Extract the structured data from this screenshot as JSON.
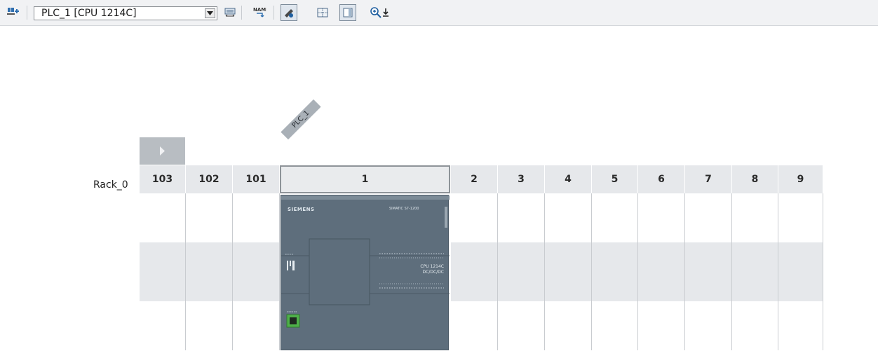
{
  "toolbar": {
    "device_selector_value": "PLC_1 [CPU 1214C]",
    "icons": [
      "network-device-icon",
      "dropdown-arrow-icon",
      "rack-overview-icon",
      "name-tag-icon",
      "show-module-icon",
      "grid-icon",
      "panel-icon",
      "zoom-in-icon",
      "download-arrow-icon"
    ]
  },
  "rack": {
    "label": "Rack_0",
    "device_tag": "PLC_1",
    "slots": [
      "103",
      "102",
      "101",
      "1",
      "2",
      "3",
      "4",
      "5",
      "6",
      "7",
      "8",
      "9"
    ]
  },
  "cpu": {
    "brand": "SIEMENS",
    "model_line": "SIMATIC S7-1200",
    "cpu_text": "CPU 1214C",
    "cpu_subtext": "DC/DC/DC"
  },
  "colors": {
    "toolbar_bg": "#f1f2f4",
    "header_bg": "#e6e8eb",
    "cpu_body": "#5e6e7c",
    "port_green": "#4fb14a"
  }
}
